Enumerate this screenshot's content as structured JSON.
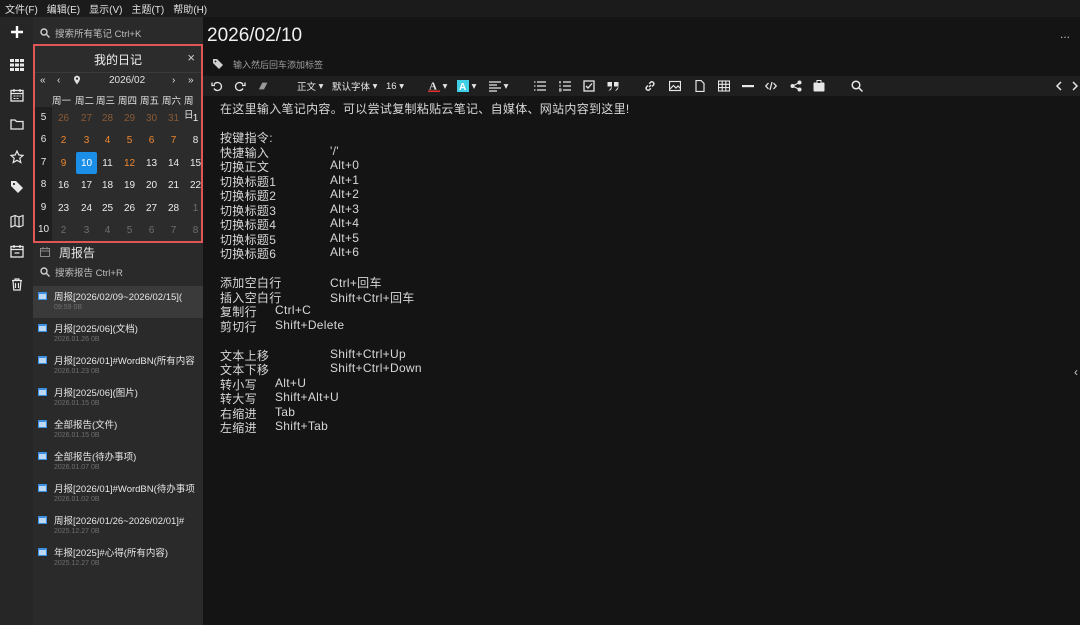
{
  "menu": [
    "文件(F)",
    "编辑(E)",
    "显示(V)",
    "主题(T)",
    "帮助(H)"
  ],
  "rail_icons": [
    "plus-icon",
    "grid-icon",
    "calendar-icon",
    "folder-icon",
    "star-icon",
    "tag-icon",
    "map-icon",
    "calendar-check-icon",
    "trash-icon"
  ],
  "search": {
    "notes_placeholder": "搜索所有笔记 Ctrl+K",
    "reports_placeholder": "搜索报告 Ctrl+R"
  },
  "calendar": {
    "title": "我的日记",
    "month": "2026/02",
    "weekdays": [
      "周一",
      "周二",
      "周三",
      "周四",
      "周五",
      "周六",
      "周日"
    ],
    "weeks": [
      "5",
      "6",
      "7",
      "8",
      "9",
      "10"
    ],
    "days": [
      [
        "26",
        "27",
        "28",
        "29",
        "30",
        "31",
        "1"
      ],
      [
        "2",
        "3",
        "4",
        "5",
        "6",
        "7",
        "8"
      ],
      [
        "9",
        "10",
        "11",
        "12",
        "13",
        "14",
        "15"
      ],
      [
        "16",
        "17",
        "18",
        "19",
        "20",
        "21",
        "22"
      ],
      [
        "23",
        "24",
        "25",
        "26",
        "27",
        "28",
        "1"
      ],
      [
        "2",
        "3",
        "4",
        "5",
        "6",
        "7",
        "8"
      ]
    ],
    "today": "10"
  },
  "weekly_report_label": "周报告",
  "reports": [
    {
      "title": "周报[2026/02/09~2026/02/15](",
      "meta": "09:59  0B"
    },
    {
      "title": "月报[2025/06](文档)",
      "meta": "2026.01.26  0B"
    },
    {
      "title": "月报[2026/01]#WordBN(所有内容",
      "meta": "2026.01.23  0B"
    },
    {
      "title": "月报[2025/06](图片)",
      "meta": "2026.01.15  0B"
    },
    {
      "title": "全部报告(文件)",
      "meta": "2026.01.15  0B"
    },
    {
      "title": "全部报告(待办事项)",
      "meta": "2026.01.07  0B"
    },
    {
      "title": "月报[2026/01]#WordBN(待办事项",
      "meta": "2026.01.02  0B"
    },
    {
      "title": "周报[2026/01/26~2026/02/01]#",
      "meta": "2025.12.27  0B"
    },
    {
      "title": "年报[2025]#心得(所有内容)",
      "meta": "2025.12.27  0B"
    }
  ],
  "editor": {
    "title": "2026/02/10",
    "more": "...",
    "tag_placeholder": "输入然后回车添加标签",
    "toolbar": {
      "style": "正文",
      "font": "默认字体",
      "size": "16"
    },
    "intro": "在这里输入笔记内容。可以尝试复制粘贴云笔记、自媒体、网站内容到这里!",
    "shortcuts_heading": "按键指令:",
    "shortcuts": [
      {
        "k": "快捷输入",
        "v": "'/'"
      },
      {
        "k": "切换正文",
        "v": "Alt+0"
      },
      {
        "k": "切换标题1",
        "v": "Alt+1"
      },
      {
        "k": "切换标题2",
        "v": "Alt+2"
      },
      {
        "k": "切换标题3",
        "v": "Alt+3"
      },
      {
        "k": "切换标题4",
        "v": "Alt+4"
      },
      {
        "k": "切换标题5",
        "v": "Alt+5"
      },
      {
        "k": "切换标题6",
        "v": "Alt+6"
      }
    ],
    "shortcuts2": [
      {
        "k": "添加空白行",
        "v": "Ctrl+回车"
      },
      {
        "k": "插入空白行",
        "v": "Shift+Ctrl+回车"
      },
      {
        "k": "复制行",
        "v": "Ctrl+C"
      },
      {
        "k": "剪切行",
        "v": "Shift+Delete"
      }
    ],
    "shortcuts3": [
      {
        "k": "文本上移",
        "v": "Shift+Ctrl+Up"
      },
      {
        "k": "文本下移",
        "v": "Shift+Ctrl+Down"
      },
      {
        "k": "转小写",
        "v": "Alt+U"
      },
      {
        "k": "转大写",
        "v": "Shift+Alt+U"
      },
      {
        "k": "右缩进",
        "v": "Tab"
      },
      {
        "k": "左缩进",
        "v": "Shift+Tab"
      }
    ]
  },
  "colors": {
    "accent": "#1b8fe8",
    "highlight_border": "#e05555",
    "weekend": "#f0882c",
    "text_color_swatch": "#e03030",
    "highlight_swatch": "#3fd0e8"
  }
}
